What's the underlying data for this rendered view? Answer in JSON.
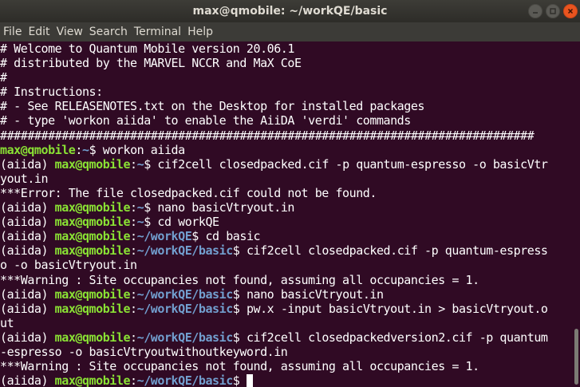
{
  "window": {
    "title": "max@qmobile: ~/workQE/basic"
  },
  "menu": [
    "File",
    "Edit",
    "View",
    "Search",
    "Terminal",
    "Help"
  ],
  "terminal": {
    "lines": [
      [
        {
          "t": "# Welcome to Quantum Mobile version 20.06.1",
          "c": ""
        }
      ],
      [
        {
          "t": "# distributed by the MARVEL NCCR and MaX CoE",
          "c": ""
        }
      ],
      [
        {
          "t": "#",
          "c": ""
        }
      ],
      [
        {
          "t": "# Instructions:",
          "c": ""
        }
      ],
      [
        {
          "t": "# - See RELEASENOTES.txt on the Desktop for installed packages",
          "c": ""
        }
      ],
      [
        {
          "t": "# - type 'workon aiida' to enable the AiiDA 'verdi' commands",
          "c": ""
        }
      ],
      [
        {
          "t": "##############################################################################",
          "c": ""
        }
      ],
      [
        {
          "t": "max@qmobile",
          "c": "host"
        },
        {
          "t": ":",
          "c": ""
        },
        {
          "t": "~",
          "c": "cwd"
        },
        {
          "t": "$ workon aiida",
          "c": ""
        }
      ],
      [
        {
          "t": "(aiida) ",
          "c": ""
        },
        {
          "t": "max@qmobile",
          "c": "host"
        },
        {
          "t": ":",
          "c": ""
        },
        {
          "t": "~",
          "c": "cwd"
        },
        {
          "t": "$ cif2cell closedpacked.cif -p quantum-espresso -o basicVtr",
          "c": ""
        }
      ],
      [
        {
          "t": "yout.in",
          "c": ""
        }
      ],
      [
        {
          "t": "***Error: The file closedpacked.cif could not be found.",
          "c": ""
        }
      ],
      [
        {
          "t": "(aiida) ",
          "c": ""
        },
        {
          "t": "max@qmobile",
          "c": "host"
        },
        {
          "t": ":",
          "c": ""
        },
        {
          "t": "~",
          "c": "cwd"
        },
        {
          "t": "$ nano basicVtryout.in",
          "c": ""
        }
      ],
      [
        {
          "t": "(aiida) ",
          "c": ""
        },
        {
          "t": "max@qmobile",
          "c": "host"
        },
        {
          "t": ":",
          "c": ""
        },
        {
          "t": "~",
          "c": "cwd"
        },
        {
          "t": "$ cd workQE",
          "c": ""
        }
      ],
      [
        {
          "t": "(aiida) ",
          "c": ""
        },
        {
          "t": "max@qmobile",
          "c": "host"
        },
        {
          "t": ":",
          "c": ""
        },
        {
          "t": "~/workQE",
          "c": "cwd"
        },
        {
          "t": "$ cd basic",
          "c": ""
        }
      ],
      [
        {
          "t": "(aiida) ",
          "c": ""
        },
        {
          "t": "max@qmobile",
          "c": "host"
        },
        {
          "t": ":",
          "c": ""
        },
        {
          "t": "~/workQE/basic",
          "c": "cwd"
        },
        {
          "t": "$ cif2cell closedpacked.cif -p quantum-espress",
          "c": ""
        }
      ],
      [
        {
          "t": "o -o basicVtryout.in",
          "c": ""
        }
      ],
      [
        {
          "t": "***Warning : Site occupancies not found, assuming all occupancies = 1.",
          "c": ""
        }
      ],
      [
        {
          "t": "(aiida) ",
          "c": ""
        },
        {
          "t": "max@qmobile",
          "c": "host"
        },
        {
          "t": ":",
          "c": ""
        },
        {
          "t": "~/workQE/basic",
          "c": "cwd"
        },
        {
          "t": "$ nano basicVtryout.in",
          "c": ""
        }
      ],
      [
        {
          "t": "(aiida) ",
          "c": ""
        },
        {
          "t": "max@qmobile",
          "c": "host"
        },
        {
          "t": ":",
          "c": ""
        },
        {
          "t": "~/workQE/basic",
          "c": "cwd"
        },
        {
          "t": "$ pw.x -input basicVtryout.in > basicVtryout.o",
          "c": ""
        }
      ],
      [
        {
          "t": "ut",
          "c": ""
        }
      ],
      [
        {
          "t": "(aiida) ",
          "c": ""
        },
        {
          "t": "max@qmobile",
          "c": "host"
        },
        {
          "t": ":",
          "c": ""
        },
        {
          "t": "~/workQE/basic",
          "c": "cwd"
        },
        {
          "t": "$ cif2cell closedpackedversion2.cif -p quantum",
          "c": ""
        }
      ],
      [
        {
          "t": "-espresso -o basicVtryoutwithoutkeyword.in",
          "c": ""
        }
      ],
      [
        {
          "t": "***Warning : Site occupancies not found, assuming all occupancies = 1.",
          "c": ""
        }
      ],
      [
        {
          "t": "(aiida) ",
          "c": ""
        },
        {
          "t": "max@qmobile",
          "c": "host"
        },
        {
          "t": ":",
          "c": ""
        },
        {
          "t": "~/workQE/basic",
          "c": "cwd"
        },
        {
          "t": "$ ",
          "c": ""
        }
      ]
    ]
  },
  "colors": {
    "background": "#300a24",
    "text": "#ffffff",
    "host": "#8ae234",
    "cwd": "#729fcf",
    "titlebar": "#3c3b37",
    "close_button": "#e9541f"
  },
  "icons": {
    "minimize": "minimize-icon",
    "maximize": "maximize-icon",
    "close": "close-icon"
  }
}
